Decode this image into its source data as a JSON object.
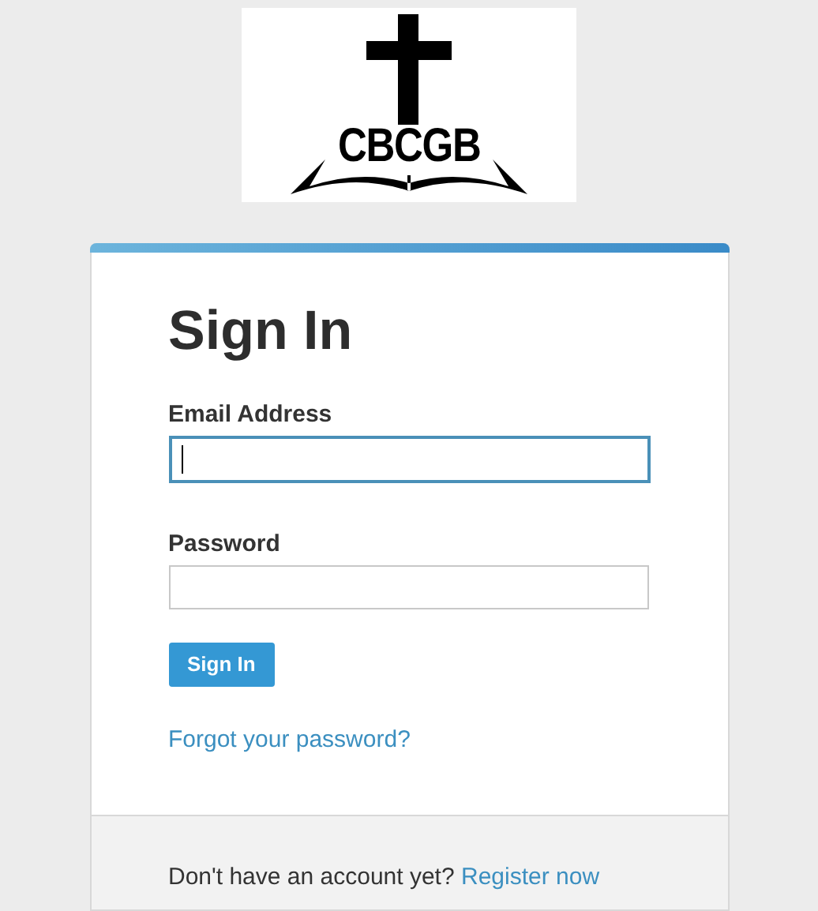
{
  "logo": {
    "text": "CBCGB"
  },
  "form": {
    "title": "Sign In",
    "fields": [
      {
        "label": "Email Address",
        "focused": true
      },
      {
        "label": "Password",
        "focused": false
      }
    ],
    "submit": "Sign In",
    "forgot_link": "Forgot your password?"
  },
  "footer": {
    "prompt": "Don't have an account yet?",
    "link": "Register now"
  }
}
